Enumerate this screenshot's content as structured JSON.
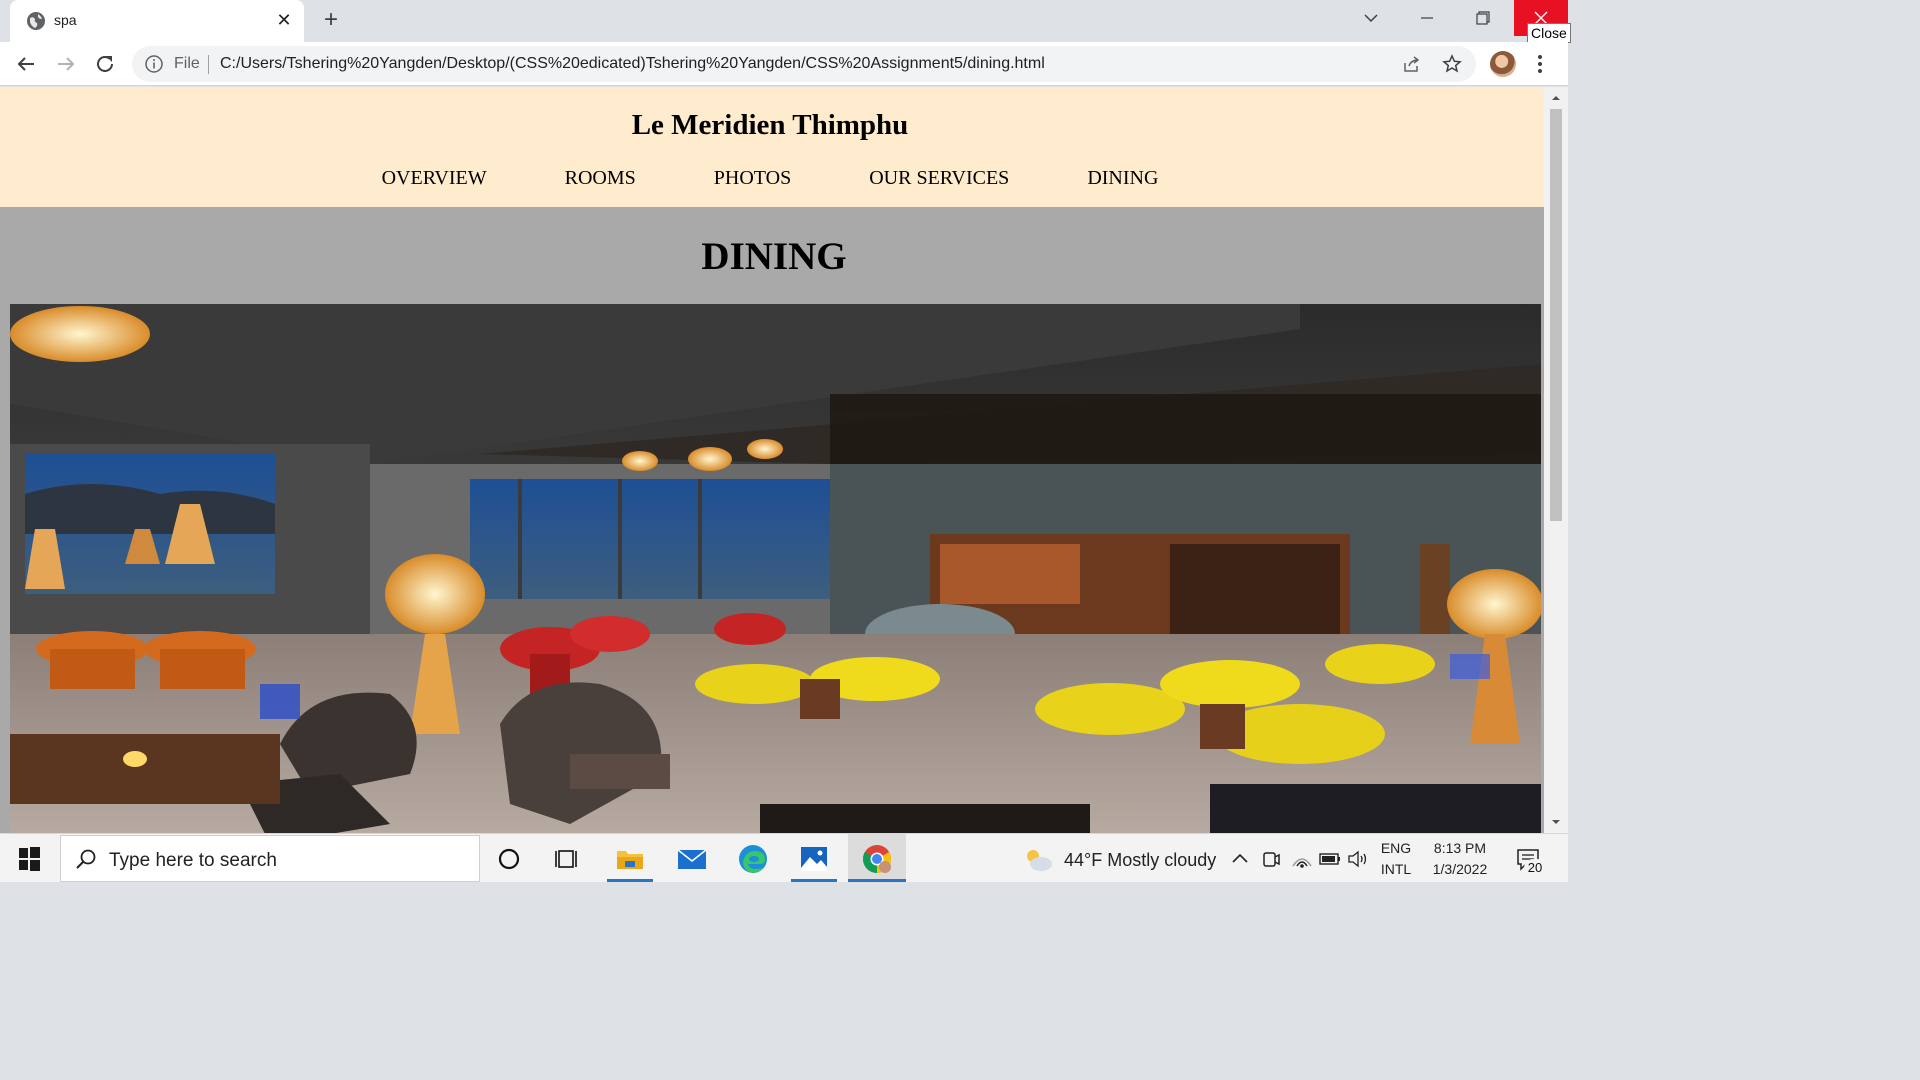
{
  "browser": {
    "tab_title": "spa",
    "tooltip": "Close",
    "file_label": "File",
    "url": "C:/Users/Tshering%20Yangden/Desktop/(CSS%20edicated)Tshering%20Yangden/CSS%20Assignment5/dining.html"
  },
  "site": {
    "title": "Le Meridien Thimphu",
    "nav": [
      "OVERVIEW",
      "ROOMS",
      "PHOTOS",
      "OUR SERVICES",
      "DINING"
    ],
    "heading": "DINING",
    "colors": {
      "header_bg": "#ffebcd",
      "page_bg": "#a9a9a9"
    }
  },
  "taskbar": {
    "search_placeholder": "Type here to search",
    "weather": "44°F  Mostly cloudy",
    "lang_top": "ENG",
    "lang_bottom": "INTL",
    "time": "8:13 PM",
    "date": "1/3/2022",
    "notifications": "20"
  }
}
